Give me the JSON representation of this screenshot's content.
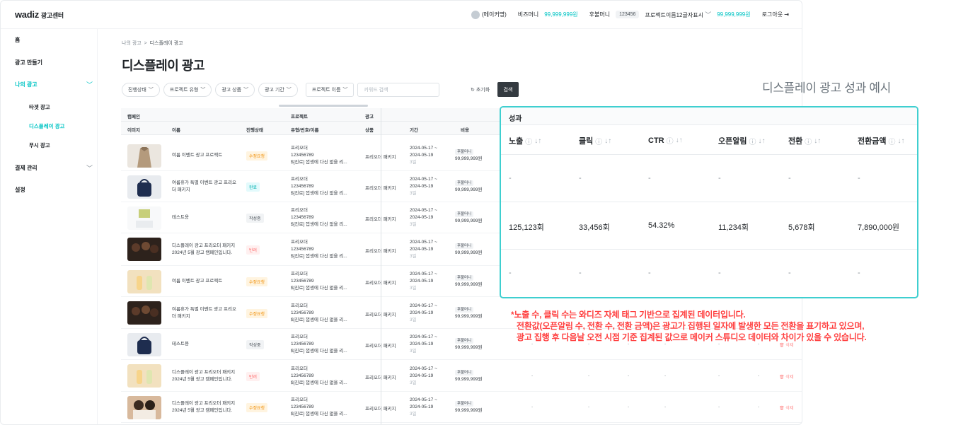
{
  "topbar": {
    "logo": "wadiz",
    "logo_sub": "광고센터",
    "maker": "(메이커명)",
    "biz_label": "비즈머니",
    "biz_value": "99,999,999원",
    "post_label": "후불머니",
    "post_id": "123456",
    "post_project": "프로젝트이름12글자표시",
    "post_value": "99,999,999원",
    "logout": "로그아웃"
  },
  "sidebar": {
    "home": "홈",
    "create": "광고 만들기",
    "my_ads": "나의 광고",
    "target_ad": "타겟 광고",
    "display_ad": "디스플레이 광고",
    "push_ad": "푸시 광고",
    "billing": "결제 관리",
    "settings": "설정"
  },
  "breadcrumb": {
    "parent": "나의 광고",
    "sep": ">",
    "current": "디스플레이 광고"
  },
  "page_title": "디스플레이 광고",
  "filters": {
    "status": "진행상태",
    "project_type": "프로젝트 유형",
    "ad_product": "광고 상품",
    "ad_period": "광고 기간",
    "project_name": "프로젝트 이름",
    "keyword_placeholder": "키워드 검색",
    "reset": "초기화",
    "search": "검색"
  },
  "table": {
    "group_campaign": "캠페인",
    "group_project": "프로젝트",
    "group_ad": "광고",
    "col_image": "이미지",
    "col_name": "이름",
    "col_status": "진행상태",
    "col_type": "유형/번호/이름",
    "col_product": "상품",
    "col_period": "기간",
    "col_cost": "비용",
    "rows": [
      {
        "name": "여름 이벤트 광고 프로젝트",
        "status": "수정요청",
        "thumb": "coat"
      },
      {
        "name": "여름휴가 특별 이벤트 광고 프리오더 패키지",
        "status": "완료",
        "thumb": "bag"
      },
      {
        "name": "테스트용",
        "status": "작성중",
        "thumb": "box"
      },
      {
        "name": "디스플레이 광고 프리오더 패키지 2024년 5월 광고 캠페인입니다.",
        "status": "반려",
        "thumb": "dark"
      },
      {
        "name": "여름 이벤트 광고 프로젝트",
        "status": "수정요청",
        "thumb": "bottles"
      },
      {
        "name": "여름휴가 특별 이벤트 광고 프리오더 패키지",
        "status": "수정요청",
        "thumb": "dark"
      },
      {
        "name": "테스트용",
        "status": "작성중",
        "thumb": "bag"
      },
      {
        "name": "디스플레이 광고 프리오더 패키지 2024년 5월 광고 캠페인입니다.",
        "status": "반려",
        "thumb": "bottles"
      },
      {
        "name": "디스플레이 광고 프리오더 패키지 2024년 5월 광고 캠페인입니다.",
        "status": "수정요청",
        "thumb": "people"
      }
    ],
    "proj_type": "프리오더",
    "proj_no": "123456789",
    "proj_name": "$[진로] 껍셍에 다신 없을 리...",
    "product": "프리오더 패키지",
    "period_start": "2024-05-17 ~",
    "period_end": "2024-05-19",
    "period_days": "3일",
    "cost_label": "후불머니",
    "cost_value": "99,999,999원",
    "dash": "-",
    "delete": "삭제"
  },
  "annotation": {
    "title": "디스플레이 광고 성과 예시",
    "perf_header": "성과",
    "columns": [
      "노출",
      "클릭",
      "CTR",
      "오픈알림",
      "전환",
      "전환금액"
    ],
    "rows": [
      [
        "-",
        "-",
        "-",
        "-",
        "-",
        "-"
      ],
      [
        "125,123회",
        "33,456회",
        "54.32%",
        "11,234회",
        "5,678회",
        "7,890,000원"
      ],
      [
        "-",
        "-",
        "-",
        "-",
        "-",
        "-"
      ]
    ],
    "note1": "*노출 수, 클릭 수는 와디즈 자체 태그 기반으로 집계된 데이터입니다.",
    "note2": "전환값(오픈알림 수, 전환 수, 전환 금액)은 광고가 집행된 일자에 발생한 모든 전환을 표기하고 있으며,",
    "note3": "광고 집행 후 다음날 오전 시점 기준 집계된 값으로 메이커 스튜디오 데이터와 차이가 있을 수 있습니다."
  },
  "colors": {
    "accent": "#00c4c4",
    "highlight_border": "#3fcfd0",
    "note": "#ff4040"
  }
}
